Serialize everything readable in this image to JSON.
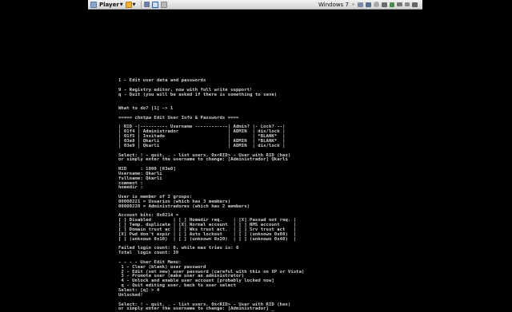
{
  "toolbar": {
    "player_label": "Player",
    "vm_name": "Windows 7",
    "icons": [
      "vmware-logo-icon",
      "play-icon",
      "pause-icon",
      "folder-icon",
      "send-ctrl-alt-del-icon",
      "fullscreen-icon",
      "unity-icon",
      "network-icon",
      "usb-icon",
      "cd-icon",
      "printer-icon",
      "sound-icon",
      "device-icon",
      "minimize-icon",
      "maximize-icon",
      "close-icon"
    ]
  },
  "terminal": {
    "lines": [
      "1 - Edit user data and passwords",
      "",
      "9 - Registry editor, now with full write support!",
      "q - Quit (you will be asked if there is something to save)",
      "",
      "",
      "What to do? [1] -> 1",
      "",
      "===== chntpw Edit User Info & Passwords ====",
      "",
      "| RID -|---------- Username ------------| Admin? |- Lock? --|",
      "| 01f4 | Administrador                  | ADMIN  | dis/lock |",
      "| 01f5 | Invitado                       |        | *BLANK*  |",
      "| 03e8 | Qkarli                         | ADMIN  | *BLANK*  |",
      "| 03e9 | Qkarli                         | ADMIN  | dis/lock |",
      "",
      "Select: ! - quit, . - list users, 0x<RID> - User with RID (hex)",
      "or simply enter the username to change: [Administrador] Qkarli",
      "",
      "RID     : 1000 [03e8]",
      "Username: Qkarli",
      "fullname: Qkarli",
      "comment :",
      "homedir :",
      "",
      "User is member of 2 groups:",
      "00000221 = Usuarios (which has 3 members)",
      "00000220 = Administradores (which has 2 members)",
      "",
      "Account bits: 0x0214 =",
      "[ ] Disabled        | [ ] Homedir req.    | [X] Passwd not req. |",
      "[ ] Temp. duplicate | [X] Normal account  | [ ] NMS account     |",
      "[ ] Domain trust ac | [ ] Wks trust act.  | [ ] Srv trust act   |",
      "[X] Pwd don't expir | [ ] Auto lockout    | [ ] (unknown 0x08)  |",
      "[ ] (unknown 0x10)  | [ ] (unknown 0x20)  | [ ] (unknown 0x40)  |",
      "",
      "Failed login count: 0, while max tries is: 0",
      "Total  login count: 39",
      "",
      "- - - - User Edit Menu:",
      " 1 - Clear (blank) user password",
      " 2 - Edit (set new) user password (careful with this on XP or Vista)",
      " 3 - Promote user (make user an administrator)",
      " 4 - Unlock and enable user account [probably locked now]",
      " q - Quit editing user, back to user select",
      "Select: [q] > 4",
      "Unlocked!",
      "",
      "Select: ! - quit, . - list users, 0x<RID> - User with RID (hex)",
      "or simply enter the username to change: [Administrador] _"
    ]
  }
}
